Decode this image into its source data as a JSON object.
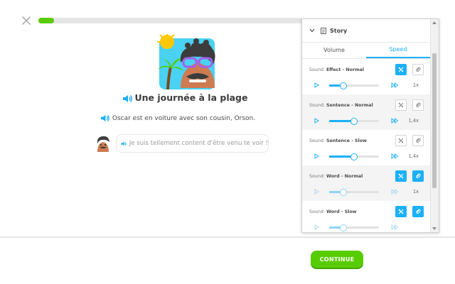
{
  "lesson": {
    "progress": 0.06,
    "title": "Une journée à la plage",
    "narration": "Oscar est en voiture avec son cousin, Orson.",
    "dialogue": "Je suis tellement content d'être venu te voir !",
    "continue_label": "CONTINUE"
  },
  "panel": {
    "title": "Story",
    "tabs": [
      {
        "label": "Volume",
        "active": false
      },
      {
        "label": "Speed",
        "active": true
      }
    ],
    "rows": [
      {
        "prefix": "Sound:",
        "name": "Effect - Normal",
        "rate": "1x",
        "level": 0.28,
        "btn1_on": true,
        "btn2_on": false,
        "disabled": false
      },
      {
        "prefix": "Sound:",
        "name": "Sentence - Normal",
        "rate": "1,4x",
        "level": 0.5,
        "btn1_on": false,
        "btn2_on": false,
        "disabled": false
      },
      {
        "prefix": "Sound:",
        "name": "Sentence - Slow",
        "rate": "1,4x",
        "level": 0.5,
        "btn1_on": false,
        "btn2_on": false,
        "disabled": false
      },
      {
        "prefix": "Sound:",
        "name": "Word - Normal",
        "rate": "1x",
        "level": 0.28,
        "btn1_on": true,
        "btn2_on": true,
        "disabled": true
      },
      {
        "prefix": "Sound:",
        "name": "Word - Slow",
        "rate": "",
        "level": 0.28,
        "btn1_on": true,
        "btn2_on": true,
        "disabled": true
      }
    ]
  },
  "colors": {
    "accent": "#1cb0f6",
    "green": "#58cc02"
  }
}
